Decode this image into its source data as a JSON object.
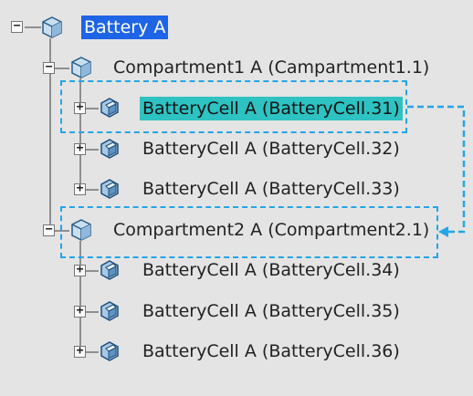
{
  "tree": {
    "root": {
      "label": "Battery A"
    },
    "compartment1": {
      "label": "Compartment1 A (Campartment1.1)"
    },
    "compartment2": {
      "label": "Compartment2 A (Compartment2.1)"
    },
    "cells": [
      {
        "label": "BatteryCell A (BatteryCell.31)"
      },
      {
        "label": "BatteryCell A (BatteryCell.32)"
      },
      {
        "label": "BatteryCell A (BatteryCell.33)"
      },
      {
        "label": "BatteryCell A (BatteryCell.34)"
      },
      {
        "label": "BatteryCell A (BatteryCell.35)"
      },
      {
        "label": "BatteryCell A (BatteryCell.36)"
      }
    ]
  },
  "icons": {
    "product": "product-icon",
    "part": "part-icon",
    "expand": "plus-icon",
    "collapse": "minus-icon"
  },
  "colors": {
    "selection": "#1e64e6",
    "highlight": "#2ec2c2",
    "annotation": "#23a5e6"
  }
}
